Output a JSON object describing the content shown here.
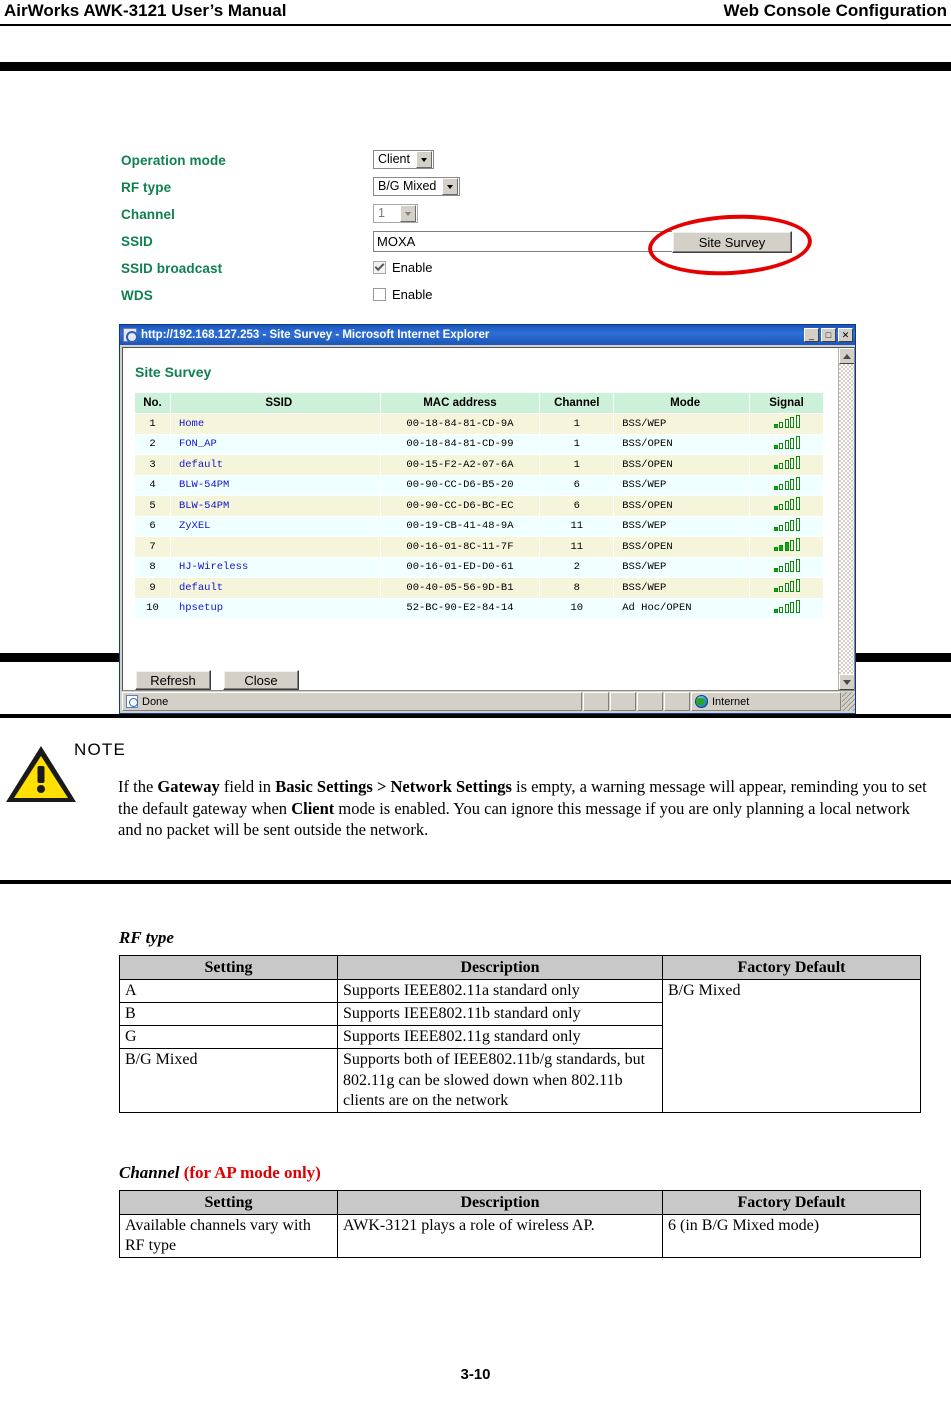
{
  "page_header": {
    "left_title": "AirWorks AWK-3121 User’s Manual",
    "right_title": "Web Console Configuration"
  },
  "console_form": {
    "rows": [
      {
        "label": "Operation mode",
        "type": "select",
        "value": "Client"
      },
      {
        "label": "RF type",
        "type": "select",
        "value": "B/G Mixed"
      },
      {
        "label": "Channel",
        "type": "select",
        "value": "1",
        "disabled": true
      },
      {
        "label": "SSID",
        "type": "text",
        "value": "MOXA"
      },
      {
        "label": "SSID broadcast",
        "type": "checkbox",
        "value": "Enable",
        "checked": true
      },
      {
        "label": "WDS",
        "type": "checkbox",
        "value": "Enable",
        "checked": false
      }
    ],
    "site_survey_button": "Site Survey",
    "label_color": "#108050",
    "annotation_color": "#e60000"
  },
  "ie_window": {
    "title": "http://192.168.127.253 - Site Survey - Microsoft Internet Explorer",
    "minimize": "_",
    "maximize": "□",
    "close": "✕",
    "page_heading": "Site Survey",
    "buttons": {
      "refresh": "Refresh",
      "close": "Close"
    },
    "status": {
      "text": "Done",
      "zone": "Internet"
    }
  },
  "survey_table": {
    "columns": [
      "No.",
      "SSID",
      "MAC address",
      "Channel",
      "Mode",
      "Signal"
    ],
    "rows": [
      {
        "no": "1",
        "ssid": "Home",
        "mac": "00-18-84-81-CD-9A",
        "channel": "1",
        "mode": "BSS/WEP",
        "signal": 1
      },
      {
        "no": "2",
        "ssid": "FON_AP",
        "mac": "00-18-84-81-CD-99",
        "channel": "1",
        "mode": "BSS/OPEN",
        "signal": 1
      },
      {
        "no": "3",
        "ssid": "default",
        "mac": "00-15-F2-A2-07-6A",
        "channel": "1",
        "mode": "BSS/OPEN",
        "signal": 1
      },
      {
        "no": "4",
        "ssid": "BLW-54PM",
        "mac": "00-90-CC-D6-B5-20",
        "channel": "6",
        "mode": "BSS/WEP",
        "signal": 1
      },
      {
        "no": "5",
        "ssid": "BLW-54PM",
        "mac": "00-90-CC-D6-BC-EC",
        "channel": "6",
        "mode": "BSS/OPEN",
        "signal": 1
      },
      {
        "no": "6",
        "ssid": "ZyXEL",
        "mac": "00-19-CB-41-48-9A",
        "channel": "11",
        "mode": "BSS/WEP",
        "signal": 1
      },
      {
        "no": "7",
        "ssid": "",
        "mac": "00-16-01-8C-11-7F",
        "channel": "11",
        "mode": "BSS/OPEN",
        "signal": 3
      },
      {
        "no": "8",
        "ssid": "HJ-Wireless",
        "mac": "00-16-01-ED-D0-61",
        "channel": "2",
        "mode": "BSS/WEP",
        "signal": 1
      },
      {
        "no": "9",
        "ssid": "default",
        "mac": "00-40-05-56-9D-B1",
        "channel": "8",
        "mode": "BSS/WEP",
        "signal": 1
      },
      {
        "no": "10",
        "ssid": "hpsetup",
        "mac": "52-BC-90-E2-84-14",
        "channel": "10",
        "mode": "Ad Hoc/OPEN",
        "signal": 1
      }
    ]
  },
  "note": {
    "label": "NOTE",
    "segments": [
      {
        "t": "If the ",
        "b": false
      },
      {
        "t": "Gateway",
        "b": true
      },
      {
        "t": " field in ",
        "b": false
      },
      {
        "t": "Basic Settings > Network Settings",
        "b": true
      },
      {
        "t": " is empty, a warning message will appear, reminding you to set the default gateway when ",
        "b": false
      },
      {
        "t": "Client",
        "b": true
      },
      {
        "t": " mode is enabled. You can ignore this message if you are only planning a local network and no packet will be sent outside the network.",
        "b": false
      }
    ]
  },
  "rf_type_section": {
    "title": "RF type",
    "headers": [
      "Setting",
      "Description",
      "Factory Default"
    ],
    "rows": [
      {
        "setting": "A",
        "description": "Supports IEEE802.11a standard only"
      },
      {
        "setting": "B",
        "description": "Supports IEEE802.11b standard only"
      },
      {
        "setting": "G",
        "description": "Supports IEEE802.11g standard only"
      },
      {
        "setting": "B/G Mixed",
        "description": "Supports both of IEEE802.11b/g standards, but 802.11g can be slowed down when 802.11b clients are on the network"
      }
    ],
    "factory_default": "B/G Mixed"
  },
  "channel_section": {
    "title": "Channel",
    "title_suffix": "(for AP mode only)",
    "headers": [
      "Setting",
      "Description",
      "Factory Default"
    ],
    "rows": [
      {
        "setting": "Available channels vary with RF type",
        "description": "AWK-3121 plays a role of wireless AP.",
        "factory_default": "6 (in B/G Mixed mode)"
      }
    ]
  },
  "footer": {
    "page_number": "3-10"
  }
}
